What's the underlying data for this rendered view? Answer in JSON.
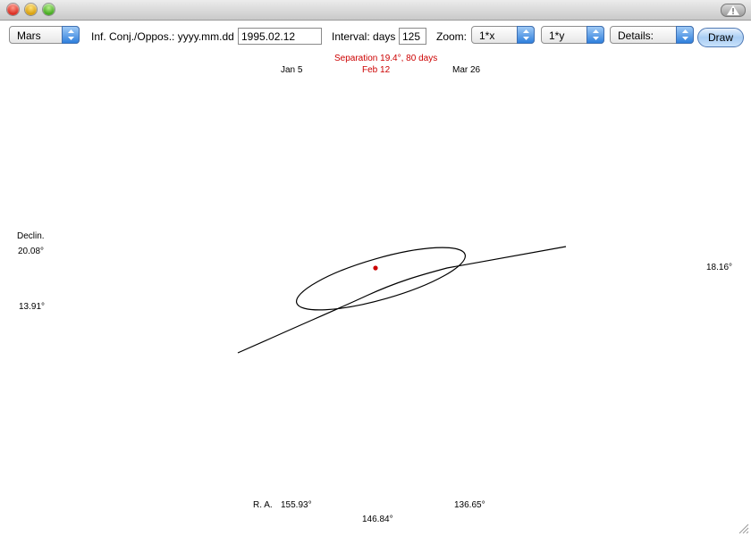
{
  "window": {
    "title": ""
  },
  "controls": {
    "planet_select": {
      "selected": "Mars"
    },
    "conj_label": "Inf. Conj./Oppos.: yyyy.mm.dd",
    "date_value": "1995.02.12",
    "interval_label": "Interval: days",
    "interval_value": "125",
    "zoom_label": "Zoom:",
    "zoom_x": {
      "selected": "1*x"
    },
    "zoom_y": {
      "selected": "1*y"
    },
    "details": {
      "selected": "Details:"
    },
    "draw_label": "Draw"
  },
  "plot": {
    "separation_label": "Separation 19.4°,  80 days",
    "dates": {
      "start": "Jan 5",
      "center": "Feb 12",
      "end": "Mar 26"
    },
    "declination_title": "Declin.",
    "dec_left_top": "20.08°",
    "dec_left_bottom": "13.91°",
    "dec_right": "18.16°",
    "ra_title": "R. A.",
    "ra_left": "155.93°",
    "ra_center": "146.84°",
    "ra_right": "136.65°",
    "colors": {
      "path": "#000000",
      "highlight": "#cc0000",
      "accent": "#2f7fdc"
    }
  }
}
